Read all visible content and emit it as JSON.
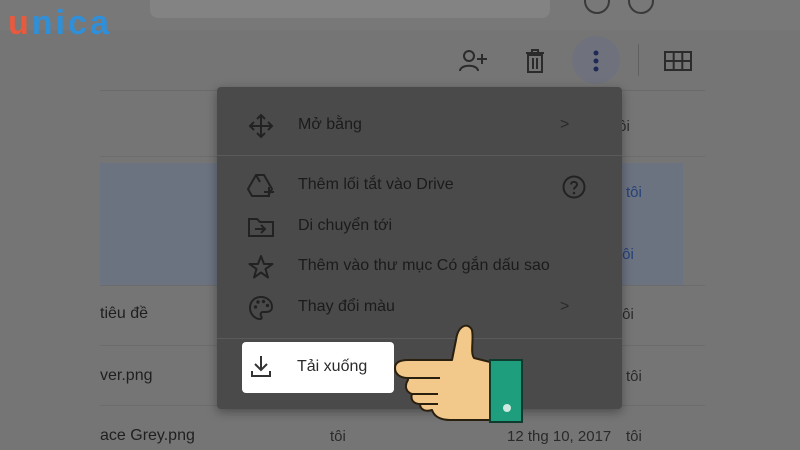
{
  "logo": {
    "letters": [
      "u",
      "n",
      "i",
      "c",
      "a"
    ],
    "colors": [
      "#e85a3e",
      "#2f8fd8",
      "#2f8fd8",
      "#2f8fd8",
      "#2f8fd8"
    ]
  },
  "toolbar": {
    "icons": [
      "add-person-icon",
      "trash-icon",
      "more-vert-icon",
      "grid-view-icon"
    ]
  },
  "file_list": {
    "header_owner": "tôi",
    "rows": [
      {
        "name": "",
        "owner": "tôi",
        "date": "",
        "selected": true
      },
      {
        "name": "",
        "owner": "tôi",
        "date": "",
        "selected": true
      },
      {
        "name": "tiêu đề",
        "owner": "tôi",
        "date": ""
      },
      {
        "name": "ver.png",
        "owner": "tôi",
        "date": ""
      },
      {
        "name": "ace Grey.png",
        "owner": "tôi",
        "date": "12 thg 10, 2017",
        "owner_left": "tôi"
      }
    ]
  },
  "context_menu": {
    "items": [
      {
        "label": "Mở bằng",
        "icon": "move-arrows-icon",
        "has_submenu": true
      },
      {
        "label": "Thêm lối tắt vào Drive",
        "icon": "drive-shortcut-icon",
        "has_help": true
      },
      {
        "label": "Di chuyển tới",
        "icon": "folder-move-icon"
      },
      {
        "label": "Thêm vào thư mục Có gắn dấu sao",
        "icon": "star-icon"
      },
      {
        "label": "Thay đổi màu",
        "icon": "palette-icon",
        "has_submenu": true
      },
      {
        "label": "Tải xuống",
        "icon": "download-icon",
        "highlighted": true
      }
    ],
    "submenu_arrow": ">"
  },
  "colors": {
    "highlight": "#ffffff",
    "hand_skin": "#f3c98b",
    "cuff": "#1f9e7e"
  }
}
